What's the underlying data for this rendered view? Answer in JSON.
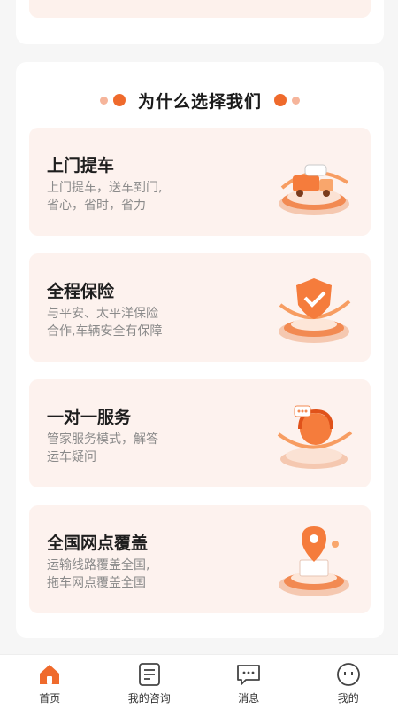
{
  "section": {
    "title": "为什么选择我们"
  },
  "features": [
    {
      "title": "上门提车",
      "desc": "上门提车，送车到门,\n省心，省时，省力",
      "icon": "truck-platform-icon"
    },
    {
      "title": "全程保险",
      "desc": "与平安、太平洋保险\n合作,车辆安全有保障",
      "icon": "shield-check-icon"
    },
    {
      "title": "一对一服务",
      "desc": "管家服务模式，解答\n运车疑问",
      "icon": "headset-service-icon"
    },
    {
      "title": "全国网点覆盖",
      "desc": "运输线路覆盖全国,\n拖车网点覆盖全国",
      "icon": "map-pin-icon"
    }
  ],
  "tabbar": {
    "items": [
      {
        "label": "首页",
        "icon": "home-icon",
        "active": true
      },
      {
        "label": "我的咨询",
        "icon": "consult-doc-icon",
        "active": false
      },
      {
        "label": "消息",
        "icon": "message-icon",
        "active": false
      },
      {
        "label": "我的",
        "icon": "profile-face-icon",
        "active": false
      }
    ]
  },
  "colors": {
    "accent": "#ef6a2c",
    "card_bg": "#fdf2ee",
    "page_bg": "#f6f6f6"
  }
}
